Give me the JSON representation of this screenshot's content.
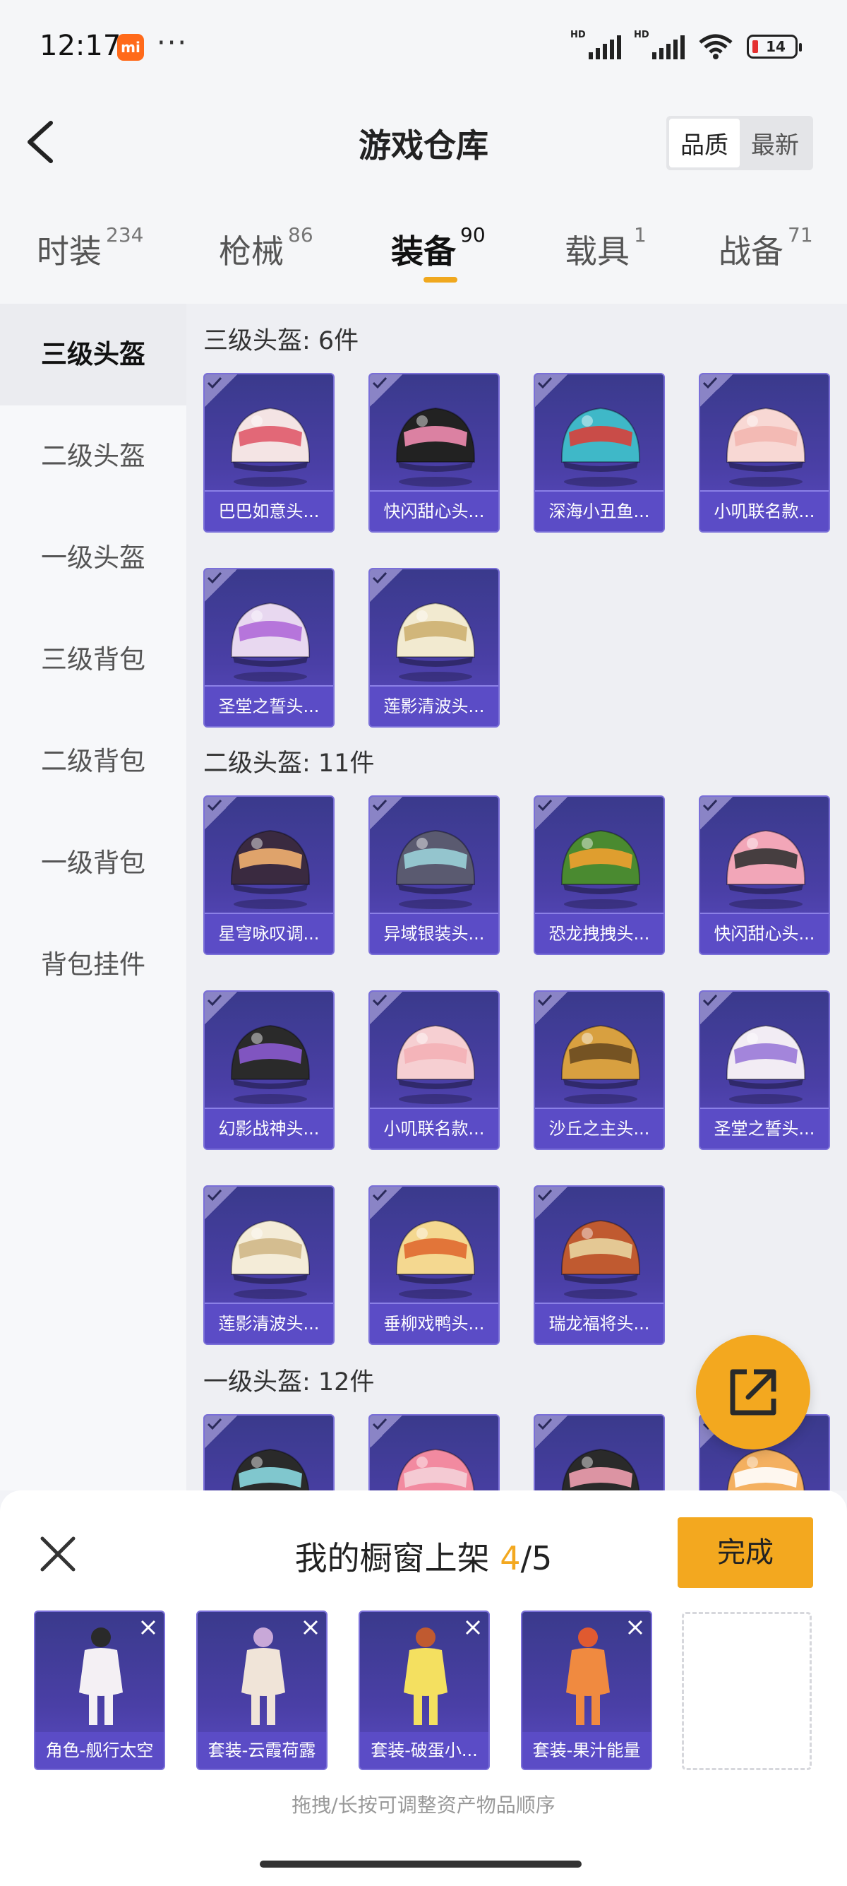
{
  "status_bar": {
    "time": "12:17",
    "battery": "14",
    "signal_label": "HD"
  },
  "header": {
    "title": "游戏仓库",
    "sort_quality": "品质",
    "sort_newest": "最新"
  },
  "tabs": [
    {
      "label": "时装",
      "count": "234"
    },
    {
      "label": "枪械",
      "count": "86"
    },
    {
      "label": "装备",
      "count": "90"
    },
    {
      "label": "载具",
      "count": "1"
    },
    {
      "label": "战备",
      "count": "71"
    }
  ],
  "sidebar": [
    "三级头盔",
    "二级头盔",
    "一级头盔",
    "三级背包",
    "二级背包",
    "一级背包",
    "背包挂件"
  ],
  "sections": [
    {
      "title": "三级头盔: 6件",
      "items": [
        "巴巴如意头...",
        "快闪甜心头...",
        "深海小丑鱼...",
        "小叽联名款...",
        "圣堂之誓头...",
        "莲影清波头..."
      ]
    },
    {
      "title": "二级头盔: 11件",
      "items": [
        "星穹咏叹调...",
        "异域银装头...",
        "恐龙拽拽头...",
        "快闪甜心头...",
        "幻影战神头...",
        "小叽联名款...",
        "沙丘之主头...",
        "圣堂之誓头...",
        "莲影清波头...",
        "垂柳戏鸭头...",
        "瑞龙福将头..."
      ]
    },
    {
      "title": "一级头盔: 12件"
    }
  ],
  "panel": {
    "title_prefix": "我的橱窗上架",
    "count_current": "4",
    "count_total": "/5",
    "done_label": "完成",
    "hint": "拖拽/长按可调整资产物品顺序",
    "showcase": [
      "角色-舰行太空",
      "套装-云霞荷露",
      "套装-破蛋小...",
      "套装-果汁能量"
    ]
  },
  "colors": {
    "accent": "#f3a81f",
    "card_bg": "#4a3fa6",
    "card_label": "#5b4cc6"
  }
}
